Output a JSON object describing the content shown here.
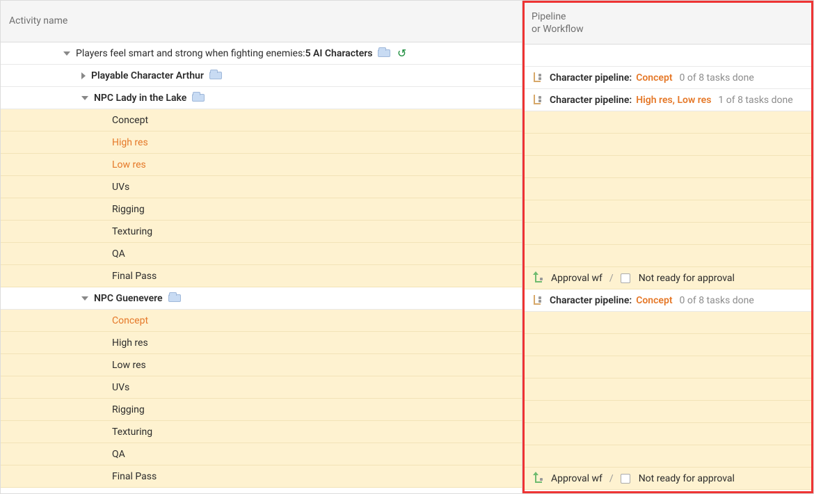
{
  "headers": {
    "left": "Activity name",
    "right": "Pipeline\nor Workflow"
  },
  "tree": {
    "epic": {
      "label_pre": "Players feel smart and strong when fighting enemies: ",
      "label_bold": "5 AI Characters"
    },
    "arthur": {
      "label": "Playable Character Arthur"
    },
    "lady": {
      "label": "NPC Lady in the Lake"
    },
    "guen": {
      "label": "NPC Guenevere"
    },
    "lady_tasks": [
      "Concept",
      "High res",
      "Low res",
      "UVs",
      "Rigging",
      "Texturing",
      "QA",
      "Final Pass"
    ],
    "guen_tasks": [
      "Concept",
      "High res",
      "Low res",
      "UVs",
      "Rigging",
      "Texturing",
      "QA",
      "Final Pass"
    ]
  },
  "pipeline": {
    "arthur": {
      "label": "Character pipeline:",
      "stage": "Concept",
      "progress": "0 of 8 tasks done"
    },
    "lady": {
      "label": "Character pipeline:",
      "stage": "High res, Low res",
      "progress": "1 of 8 tasks done"
    },
    "guen": {
      "label": "Character pipeline:",
      "stage": "Concept",
      "progress": "0 of 8 tasks done"
    },
    "approval_wf": "Approval wf",
    "sep": "/",
    "not_ready": "Not ready for approval"
  },
  "lady_task_orange": {
    "Concept": false,
    "High res": true,
    "Low res": true,
    "UVs": false,
    "Rigging": false,
    "Texturing": false,
    "QA": false,
    "Final Pass": false
  },
  "guen_task_orange": {
    "Concept": true,
    "High res": false,
    "Low res": false,
    "UVs": false,
    "Rigging": false,
    "Texturing": false,
    "QA": false,
    "Final Pass": false
  }
}
